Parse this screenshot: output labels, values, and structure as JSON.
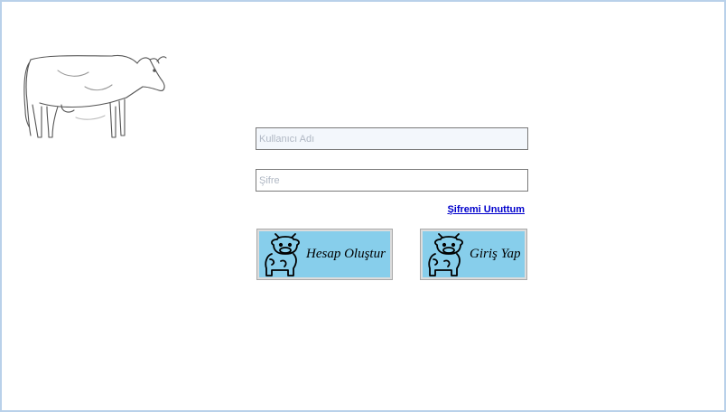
{
  "logo": {
    "icon": "cow-sketch-icon"
  },
  "form": {
    "username_placeholder": "Kullanıcı Adı",
    "username_value": "",
    "password_placeholder": "Şifre",
    "password_value": "",
    "forgot_password_label": "Şifremi Unuttum"
  },
  "buttons": {
    "register_label": "Hesap Oluştur",
    "register_icon": "cow-icon",
    "login_label": "Giriş Yap",
    "login_icon": "cow-icon",
    "button_color": "#87ceeb"
  },
  "colors": {
    "window_border": "#b9d1ea",
    "link": "#0000cc"
  }
}
